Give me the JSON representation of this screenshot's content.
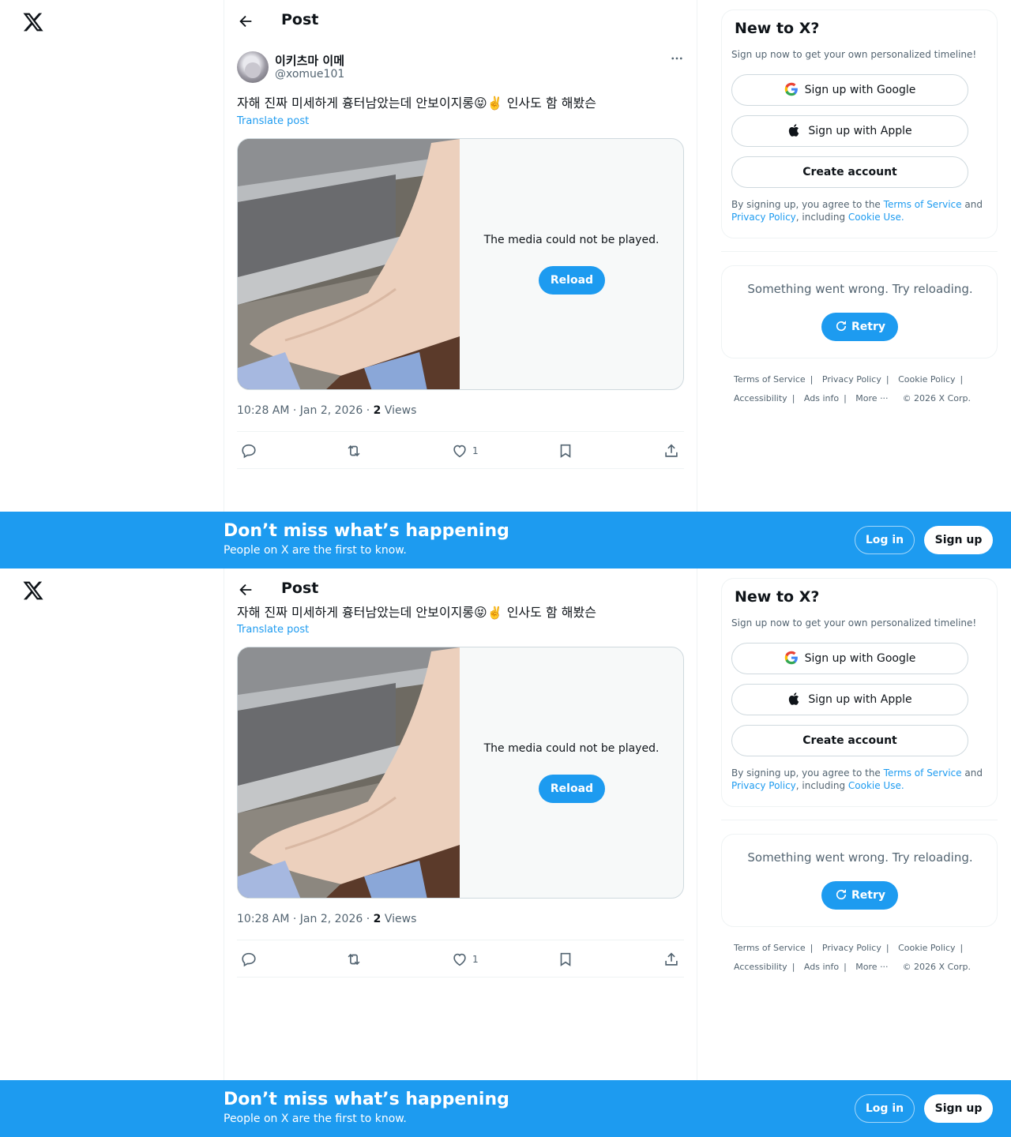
{
  "header": {
    "title": "Post"
  },
  "post": {
    "author_name": "이키츠마 이메",
    "author_handle": "@xomue101",
    "text": "자해 진짜 미세하게 흉터남았는데 안보이지롱😝✌️ 인사도 함 해봤슨",
    "translate_label": "Translate post",
    "media_error": "The media could not be played.",
    "reload_label": "Reload",
    "time": "10:28 AM · Jan 2, 2026",
    "views_count": "2",
    "views_label": "Views",
    "like_count": "1"
  },
  "signup_card": {
    "title": "New to X?",
    "subtitle": "Sign up now to get your own personalized timeline!",
    "google_label": "Sign up with Google",
    "apple_label": "Sign up with Apple",
    "create_label": "Create account",
    "legal_prefix": "By signing up, you agree to the",
    "terms_link": "Terms of Service",
    "legal_and": "and",
    "privacy_link": "Privacy Policy",
    "legal_including": ", including",
    "cookie_link": "Cookie Use."
  },
  "error_card": {
    "message": "Something went wrong. Try reloading.",
    "retry_label": "Retry"
  },
  "footer": {
    "terms": "Terms of Service",
    "privacy": "Privacy Policy",
    "cookie": "Cookie Policy",
    "accessibility": "Accessibility",
    "ads": "Ads info",
    "more": "More ···",
    "copyright": "© 2026 X Corp."
  },
  "banner": {
    "title": "Don’t miss what’s happening",
    "subtitle": "People on X are the first to know.",
    "login_label": "Log in",
    "signup_label": "Sign up"
  },
  "colors": {
    "accent": "#1d9bf0",
    "text": "#0f1419",
    "secondary": "#536471",
    "border": "#eff3f4"
  }
}
